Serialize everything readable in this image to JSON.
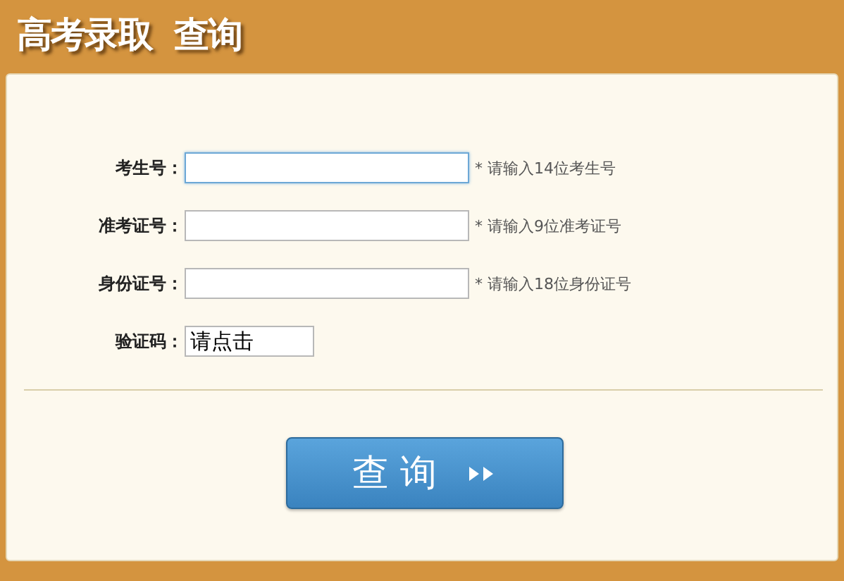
{
  "header": {
    "title": "高考录取  查询"
  },
  "fields": [
    {
      "label": "考生号：",
      "kind": "text",
      "hint": "* 请输入14位考生号",
      "focused": true
    },
    {
      "label": "准考证号：",
      "kind": "text",
      "hint": "* 请输入9位准考证号",
      "focused": false
    },
    {
      "label": "身份证号：",
      "kind": "text",
      "hint": "* 请输入18位身份证号",
      "focused": false
    },
    {
      "label": "验证码：",
      "kind": "captcha",
      "value": "请点击",
      "focused": false
    }
  ],
  "submit": {
    "label": "查 询"
  }
}
